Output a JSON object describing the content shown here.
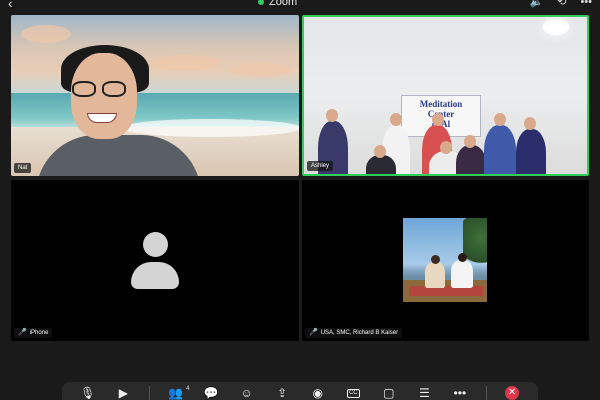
{
  "header": {
    "title": "Zoom",
    "icons": [
      "back-icon",
      "speaker-icon",
      "camera-switch-icon",
      "more-icon"
    ],
    "status_color": "#2fcf5a"
  },
  "tiles": [
    {
      "name": "Nat",
      "muted": false,
      "active_speaker": false,
      "content": "video-beach-background"
    },
    {
      "name": "Ashley",
      "muted": false,
      "active_speaker": true,
      "content": "video-group",
      "sign_lines": [
        "Meditation",
        "Center",
        "of Al"
      ]
    },
    {
      "name": "iPhone",
      "muted": true,
      "active_speaker": false,
      "content": "avatar-placeholder"
    },
    {
      "name": "USA, SMC, Richard B Kaiser",
      "muted": true,
      "active_speaker": false,
      "content": "profile-photo"
    }
  ],
  "toolbar": {
    "participants_count": "4",
    "cc_label": "CC",
    "buttons": [
      "mic-icon",
      "video-icon",
      "participants-icon",
      "chat-icon",
      "reactions-icon",
      "share-icon",
      "record-icon",
      "captions-icon",
      "apps-icon",
      "notes-icon",
      "more-icon",
      "end-icon"
    ]
  },
  "colors": {
    "accent": "#2fcf5a",
    "end": "#e0364a",
    "muted": "#e23c3c"
  }
}
